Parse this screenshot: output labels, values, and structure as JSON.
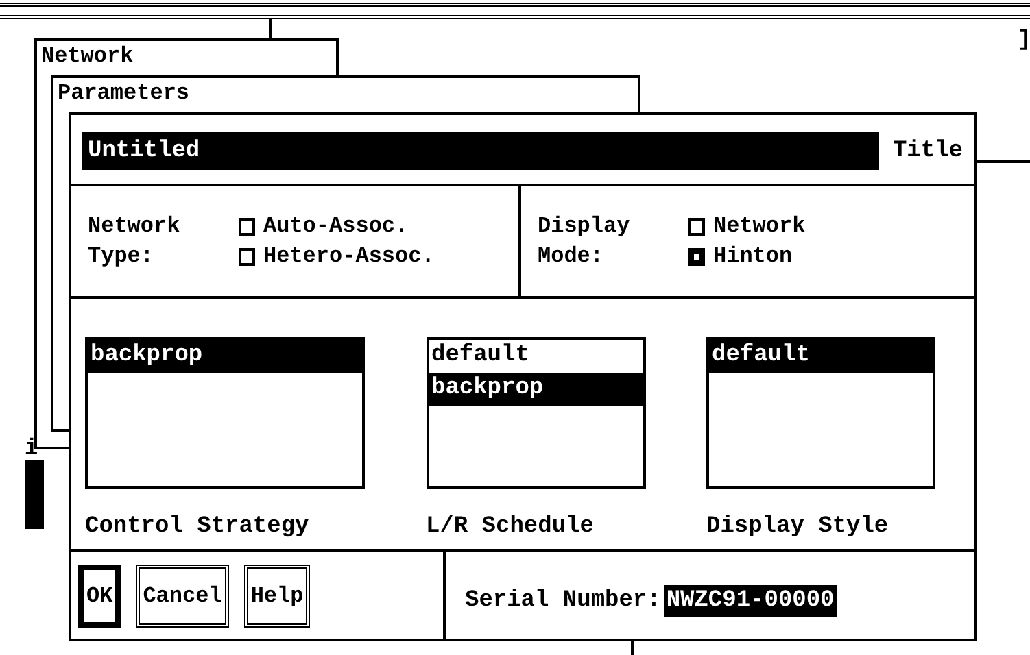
{
  "background": {
    "network_window": {
      "title": "Network"
    },
    "parameters_window": {
      "title": "Parameters"
    },
    "corner_mark": "]",
    "left_fragment": "i"
  },
  "dialog": {
    "title_field": {
      "value": "Untitled",
      "label": "Title"
    },
    "network_type": {
      "label": "Network Type:",
      "options": [
        {
          "label": "Auto-Assoc.",
          "selected": false
        },
        {
          "label": "Hetero-Assoc.",
          "selected": false
        }
      ]
    },
    "display_mode": {
      "label": "Display Mode:",
      "options": [
        {
          "label": "Network",
          "selected": false
        },
        {
          "label": "Hinton",
          "selected": true
        }
      ]
    },
    "lists": [
      {
        "caption": "Control Strategy",
        "items": [
          {
            "label": "backprop",
            "selected": true
          }
        ]
      },
      {
        "caption": "L/R Schedule",
        "items": [
          {
            "label": "default",
            "selected": false
          },
          {
            "label": "backprop",
            "selected": true
          }
        ]
      },
      {
        "caption": "Display Style",
        "items": [
          {
            "label": "default",
            "selected": true
          }
        ]
      }
    ],
    "buttons": [
      {
        "label": "OK",
        "default": true
      },
      {
        "label": "Cancel",
        "default": false
      },
      {
        "label": "Help",
        "default": false
      }
    ],
    "serial": {
      "label": "Serial Number:",
      "value": "NWZC91-00000"
    }
  }
}
